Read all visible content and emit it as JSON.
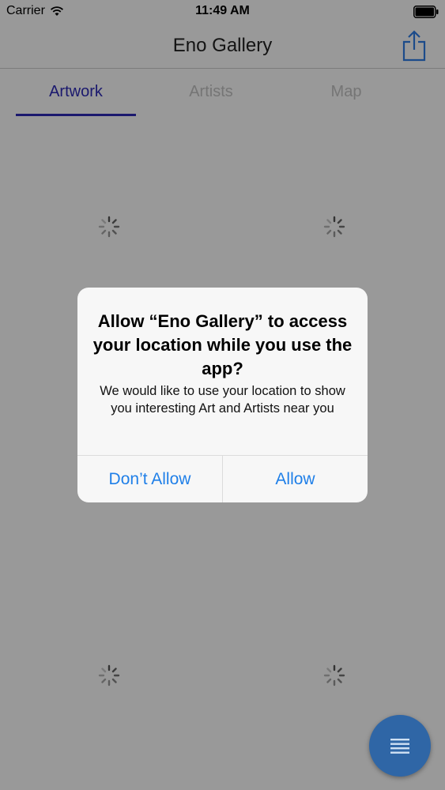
{
  "status_bar": {
    "carrier": "Carrier",
    "time": "11:49 AM"
  },
  "nav": {
    "title": "Eno Gallery",
    "share_icon": "share-icon"
  },
  "tabs": [
    {
      "label": "Artwork",
      "selected": true
    },
    {
      "label": "Artists",
      "selected": false
    },
    {
      "label": "Map",
      "selected": false
    }
  ],
  "colors": {
    "accent": "#2d2bb8",
    "ios_blue": "#1f7fe8",
    "fab": "#2f66a6"
  },
  "alert": {
    "title": "Allow “Eno Gallery” to access your location while you use the app?",
    "message": "We would like to use your location to show you interesting Art and Artists near you",
    "deny_label": "Don’t Allow",
    "allow_label": "Allow"
  },
  "fab": {
    "icon": "menu-icon"
  }
}
